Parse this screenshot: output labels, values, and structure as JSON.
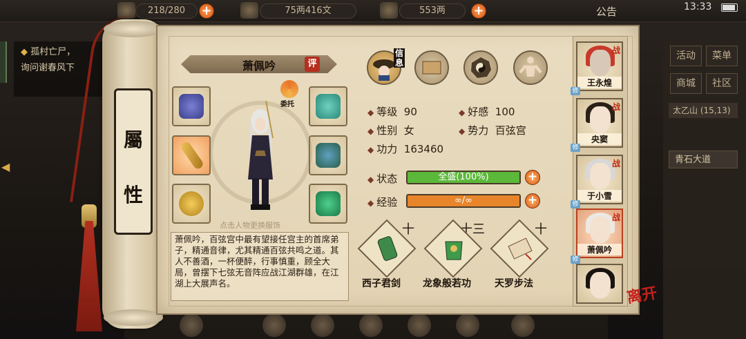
{
  "topbar": {
    "res1_value": "218/280",
    "res2_value": "75两416文",
    "res3_value": "553两",
    "notice": "公告",
    "clock": "13:33"
  },
  "quest": {
    "line1": "孤村亡尸，",
    "line2": "询问谢春风下"
  },
  "right_menu": {
    "activity": "活动",
    "menu": "菜单",
    "shop": "商城",
    "community": "社区",
    "location": "太乙山",
    "coords": "(15,13)",
    "road": "青石大道"
  },
  "scroll": {
    "attr_line1": "屬",
    "attr_line2": "性"
  },
  "character": {
    "name": "萧佩吟",
    "eval": "评",
    "weituo": "委托",
    "hint": "点击人物更换服饰",
    "description": "萧佩吟，百弦宫中最有望接任宫主的首席弟子，精通音律，尤其精通百弦共鸣之道。其人不善酒，一杯便醉，行事慎重，顾全大局，曾摆下七弦无音阵应战江湖群雄，在江湖上大展声名。"
  },
  "tabs": {
    "info_label": "信息"
  },
  "stats": {
    "level_label": "等级",
    "level_value": "90",
    "favor_label": "好感",
    "favor_value": "100",
    "gender_label": "性别",
    "gender_value": "女",
    "faction_label": "势力",
    "faction_value": "百弦宫",
    "power_label": "功力",
    "power_value": "163460",
    "state_label": "状态",
    "state_value": "全盛(100%)",
    "state_fraction": 1.0,
    "exp_label": "经验",
    "exp_value": "∞/∞",
    "exp_fraction": 1.0
  },
  "skills": [
    {
      "name": "西子君剑",
      "level": "十"
    },
    {
      "name": "龙象般若功",
      "level": "十三"
    },
    {
      "name": "天罗步法",
      "level": "十"
    }
  ],
  "team": [
    {
      "name": "王永煌",
      "battle": "战",
      "cultivate": "修"
    },
    {
      "name": "央窦",
      "battle": "战",
      "cultivate": "修"
    },
    {
      "name": "于小雪",
      "battle": "战",
      "cultivate": "修"
    },
    {
      "name": "萧佩吟",
      "battle": "战",
      "cultivate": "修"
    },
    {
      "name": "",
      "battle": "",
      "cultivate": ""
    }
  ],
  "leave_label": "离开",
  "colors": {
    "state_bar": "#5cb83a",
    "exp_bar": "#e8852a",
    "accent_red": "#b52f1e",
    "paper": "#e6d8bb"
  }
}
